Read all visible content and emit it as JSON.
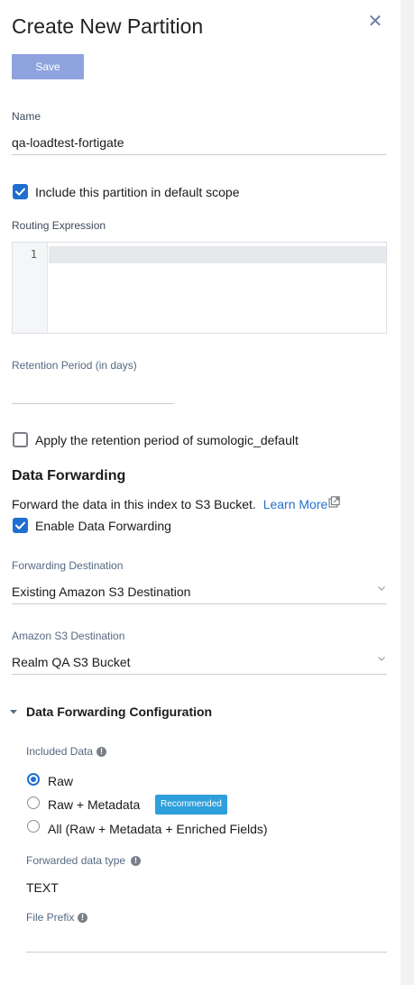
{
  "dialog": {
    "title": "Create New Partition",
    "close_icon": "close-icon",
    "save_label": "Save"
  },
  "name_field": {
    "label": "Name",
    "value": "qa-loadtest-fortigate"
  },
  "default_scope": {
    "label": "Include this partition in default scope",
    "checked": true
  },
  "routing": {
    "label": "Routing Expression",
    "line_number": "1",
    "value": ""
  },
  "retention": {
    "label": "Retention Period (in days)",
    "value": ""
  },
  "apply_retention": {
    "label": "Apply the retention period of sumologic_default",
    "checked": false
  },
  "data_forwarding": {
    "heading": "Data Forwarding",
    "description": "Forward the data in this index to S3 Bucket.",
    "learn_more": "Learn More",
    "enable_label": "Enable Data Forwarding",
    "enabled": true,
    "destination_label": "Forwarding Destination",
    "destination_value": "Existing Amazon S3 Destination",
    "s3_label": "Amazon S3 Destination",
    "s3_value": "Realm QA S3 Bucket"
  },
  "config": {
    "heading": "Data Forwarding Configuration",
    "expanded": true,
    "included_label": "Included Data",
    "options": [
      {
        "label": "Raw",
        "selected": true
      },
      {
        "label": "Raw + Metadata",
        "selected": false
      },
      {
        "label": "All (Raw + Metadata + Enriched Fields)",
        "selected": false
      }
    ],
    "recommended_badge": "Recommended",
    "type_label": "Forwarded data type",
    "type_value": "TEXT",
    "prefix_label": "File Prefix",
    "prefix_value": ""
  },
  "colors": {
    "accent": "#1f6fd1",
    "save_button": "#8ea3de",
    "badge": "#2e9fdb"
  }
}
